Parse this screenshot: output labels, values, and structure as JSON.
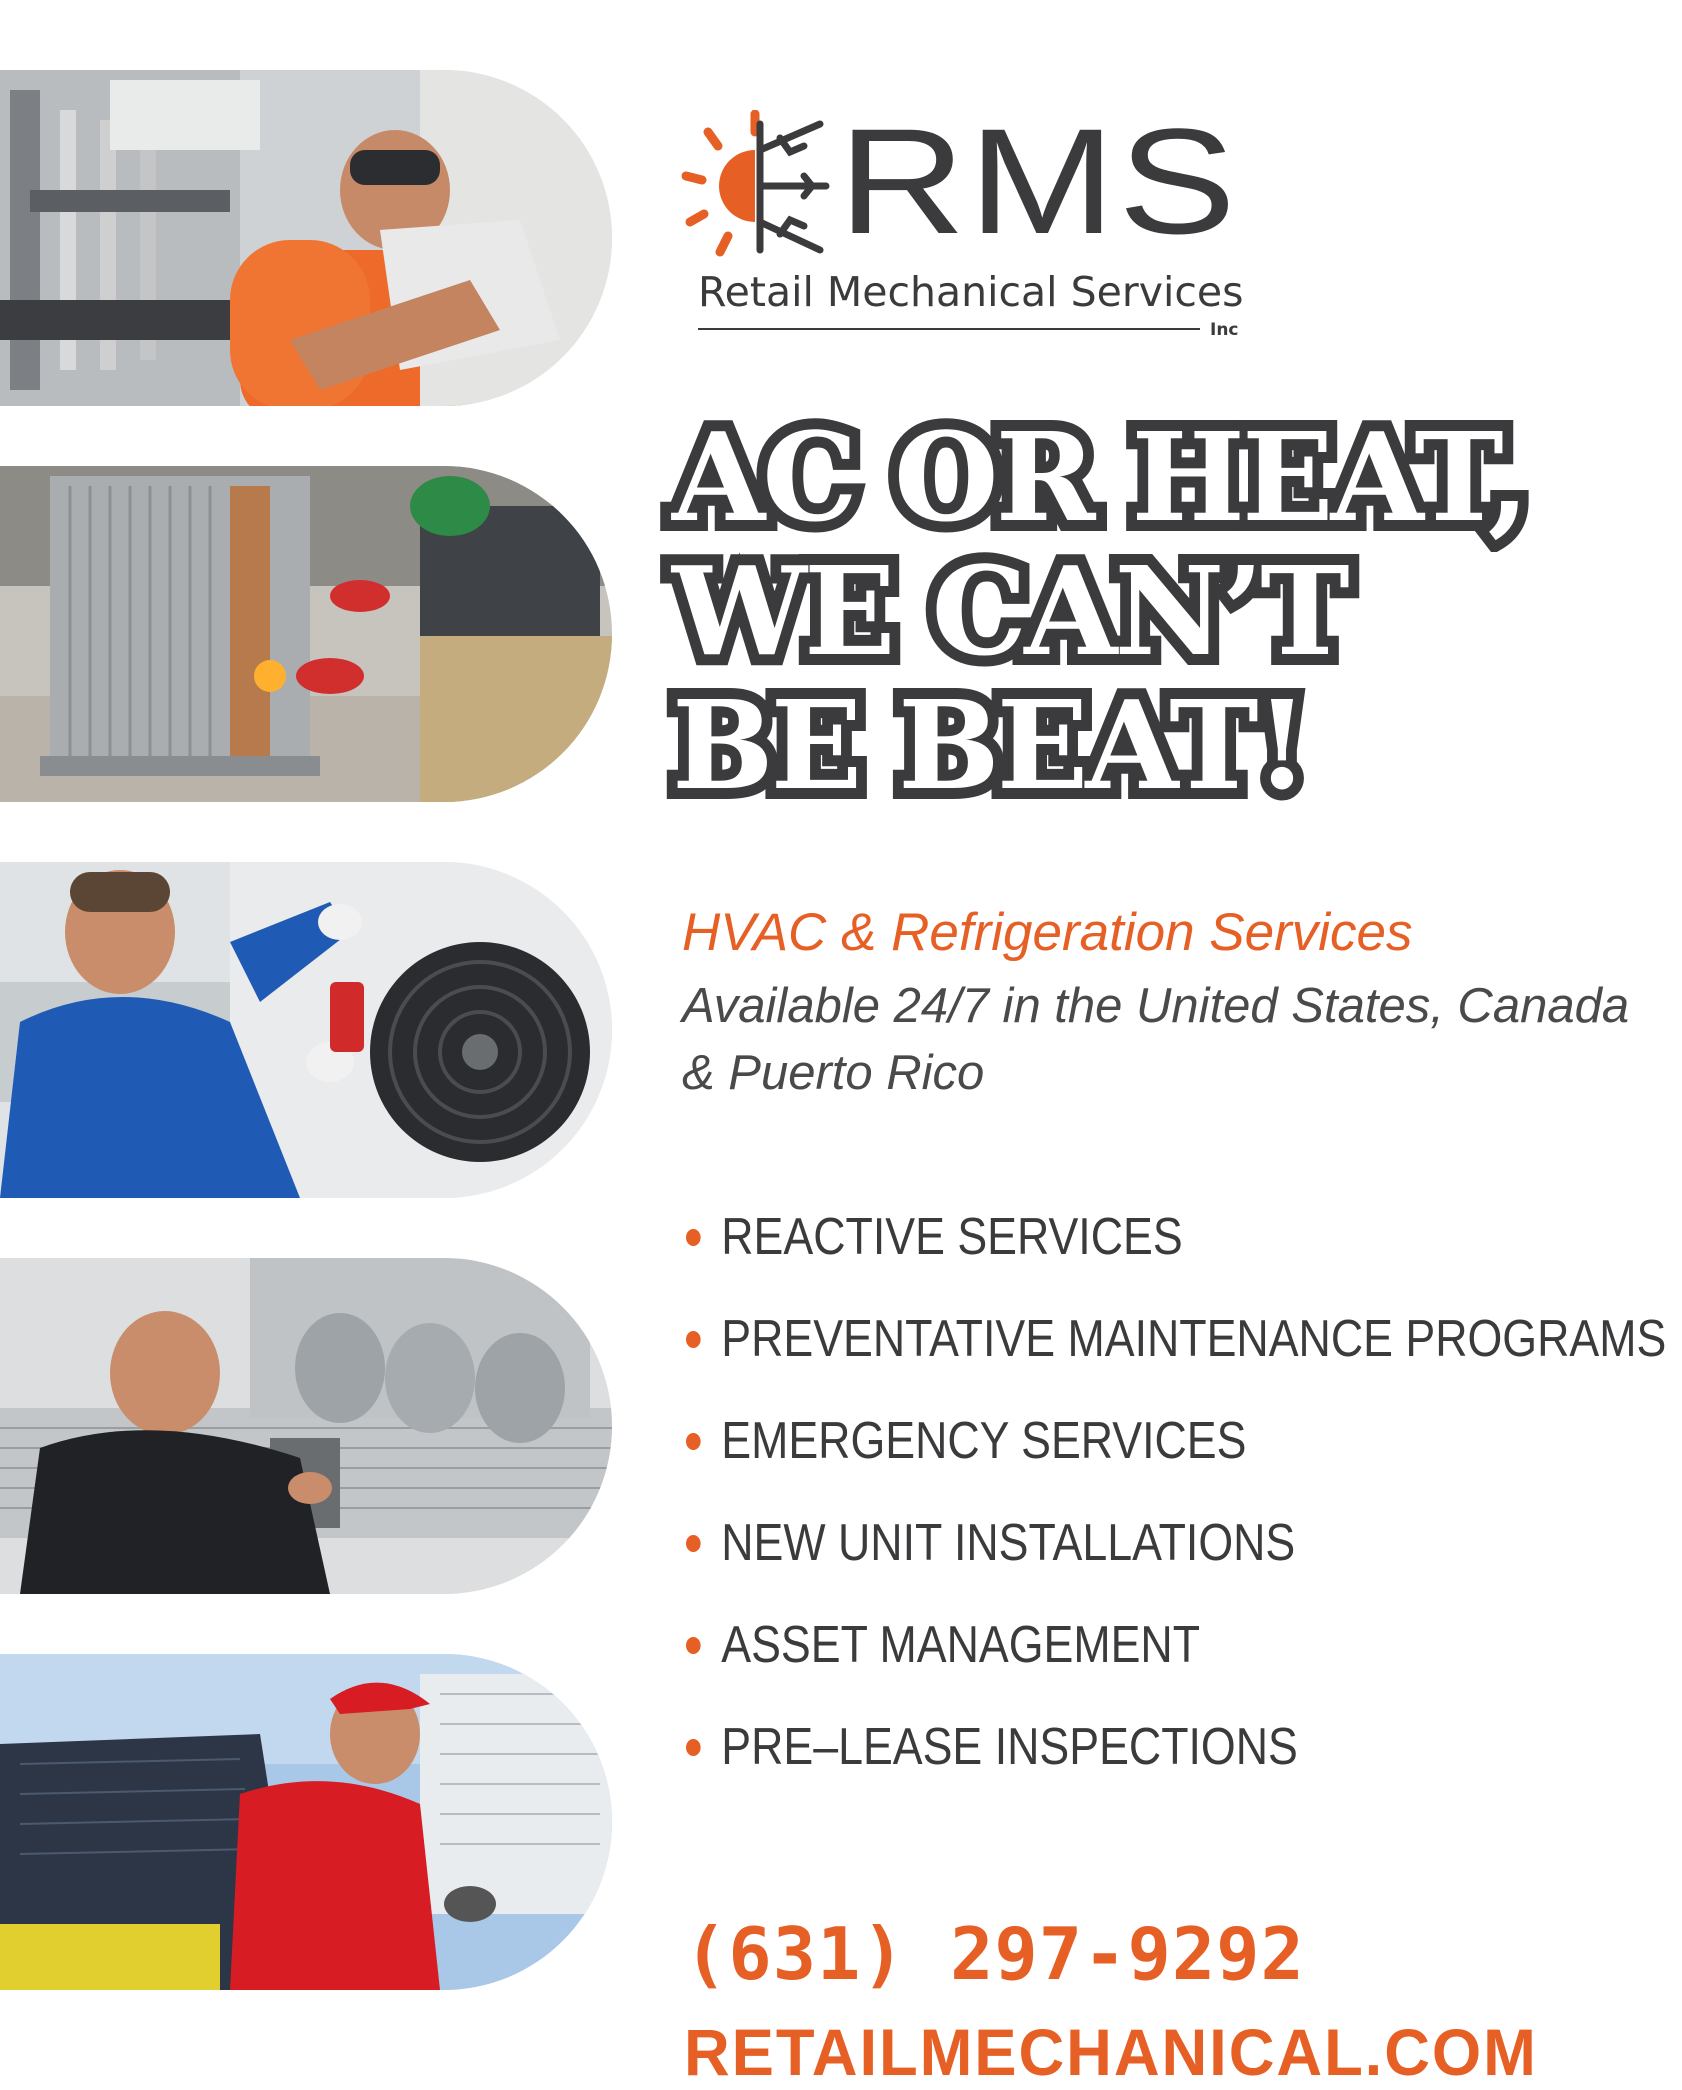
{
  "brand": {
    "abbr": "RMS",
    "name": "Retail Mechanical Services",
    "suffix": "Inc",
    "mark_icon": "sun-snowflake-icon",
    "colors": {
      "accent": "#e65f25",
      "dark": "#3b3b3d"
    }
  },
  "headline": {
    "lines": [
      "AC OR HEAT,",
      "WE CAN’T",
      "BE BEAT!"
    ]
  },
  "tagline": {
    "primary": "HVAC & Refrigeration Services",
    "secondary": "Available 24/7 in the United States, Canada & Puerto Rico"
  },
  "services": [
    "REACTIVE SERVICES",
    "PREVENTATIVE MAINTENANCE PROGRAMS",
    "EMERGENCY SERVICES",
    "NEW UNIT INSTALLATIONS",
    "ASSET MANAGEMENT",
    "PRE–LEASE INSPECTIONS"
  ],
  "contact": {
    "phone": "(631) 297-9292",
    "website": "RETAILMECHANICAL.COM"
  },
  "photos": [
    {
      "subject": "technician-water-heater-photo"
    },
    {
      "subject": "technician-condenser-brazing-photo"
    },
    {
      "subject": "technician-fan-unit-meter-photo"
    },
    {
      "subject": "technician-ductwork-photo"
    },
    {
      "subject": "technician-rooftop-ac-photo"
    }
  ]
}
